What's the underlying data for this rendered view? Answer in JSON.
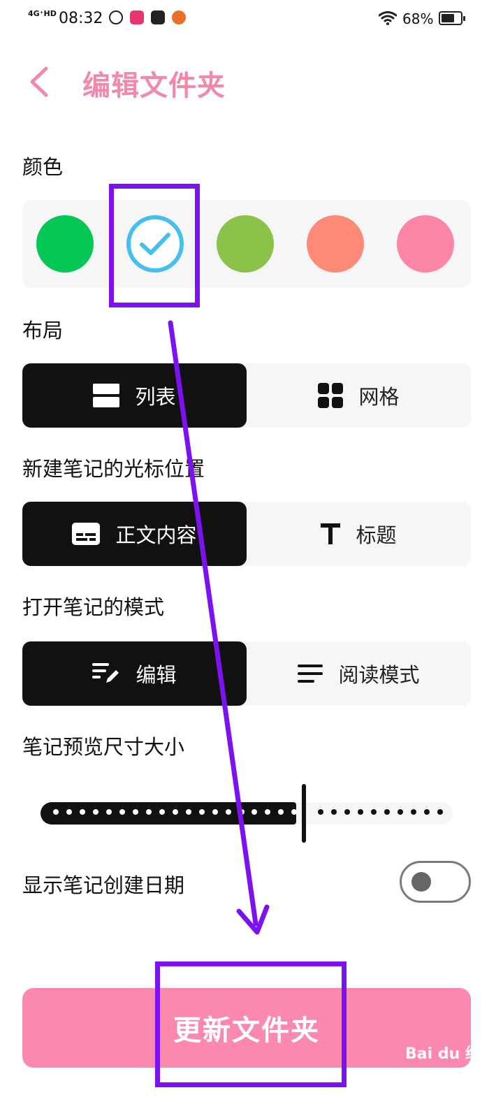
{
  "status_bar": {
    "network": "4G⁺HD",
    "time": "08:32",
    "battery": "68%",
    "battery_level": 0.68,
    "icons": [
      "notification-icon",
      "notification-icon",
      "media-icon",
      "notification-icon"
    ]
  },
  "header": {
    "back_icon": "chevron-left-icon",
    "title": "编辑文件夹"
  },
  "color_section": {
    "label": "颜色",
    "swatches": [
      {
        "color": "#06c755",
        "selected": false
      },
      {
        "color": "#45c0ee",
        "selected": true
      },
      {
        "color": "#8bc34a",
        "selected": false
      },
      {
        "color": "#fd8a76",
        "selected": false
      },
      {
        "color": "#fd85a6",
        "selected": false
      }
    ]
  },
  "layout_section": {
    "label": "布局",
    "options": [
      {
        "label": "列表",
        "icon": "list-view-icon",
        "active": true
      },
      {
        "label": "网格",
        "icon": "grid-view-icon",
        "active": false
      }
    ]
  },
  "cursor_section": {
    "label": "新建笔记的光标位置",
    "options": [
      {
        "label": "正文内容",
        "icon": "body-text-icon",
        "active": true
      },
      {
        "label": "标题",
        "icon": "title-text-icon",
        "active": false
      }
    ]
  },
  "open_mode_section": {
    "label": "打开笔记的模式",
    "options": [
      {
        "label": "编辑",
        "icon": "edit-icon",
        "active": true
      },
      {
        "label": "阅读模式",
        "icon": "reading-mode-icon",
        "active": false
      }
    ]
  },
  "preview_size_section": {
    "label": "笔记预览尺寸大小",
    "slider_value": 0.62
  },
  "date_section": {
    "label": "显示笔记创建日期",
    "toggle_on": false
  },
  "footer": {
    "update_button": "更新文件夹"
  },
  "watermark": "Bai du 经验",
  "colors": {
    "accent": "#f18aa9",
    "button": "#fb89ad",
    "annotation": "#7c12f0"
  }
}
